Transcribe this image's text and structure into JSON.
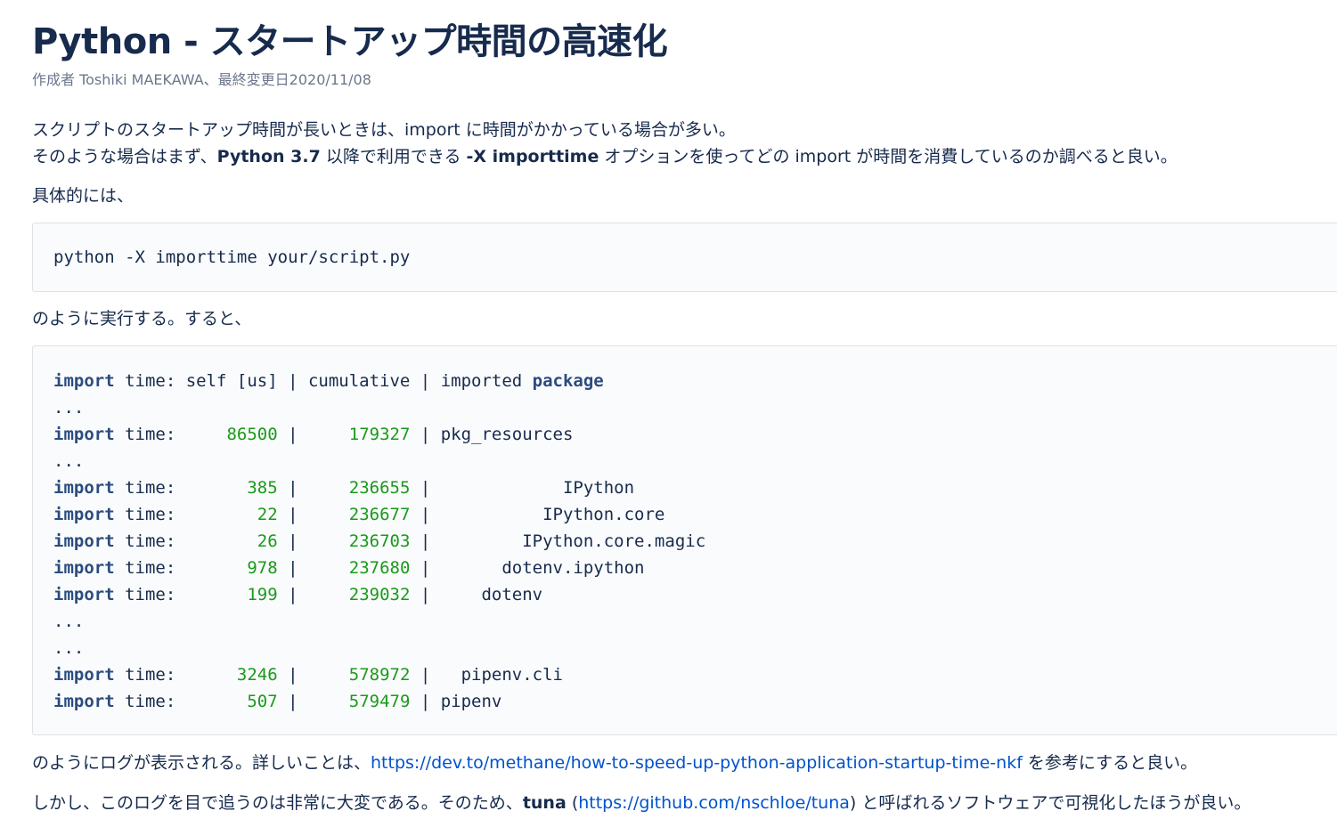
{
  "title": "Python - スタートアップ時間の高速化",
  "meta": "作成者 Toshiki MAEKAWA、最終変更日2020/11/08",
  "intro": {
    "line1": "スクリプトのスタートアップ時間が長いときは、import に時間がかかっている場合が多い。",
    "line2_a": "そのような場合はまず、",
    "line2_b": "Python 3.7",
    "line2_c": " 以降で利用できる ",
    "line2_d": "-X importtime",
    "line2_e": " オプションを使ってどの import が時間を消費しているのか調べると良い。"
  },
  "concretely": "具体的には、",
  "command": "python -X importtime your/script.py",
  "run_text": "のように実行する。すると、",
  "log": {
    "header": {
      "kw": "import",
      "mid": " time: self [us] | cumulative | imported ",
      "kw2": "package"
    },
    "rows": [
      {
        "type": "ellipsis",
        "text": "..."
      },
      {
        "type": "row",
        "kw": "import",
        "label": " time: ",
        "self": "    86500",
        "sep1": " | ",
        "cum": "    179327",
        "sep2": " | ",
        "pkg": "pkg_resources"
      },
      {
        "type": "ellipsis",
        "text": "..."
      },
      {
        "type": "row",
        "kw": "import",
        "label": " time: ",
        "self": "      385",
        "sep1": " | ",
        "cum": "    236655",
        "sep2": " | ",
        "pkg": "            IPython"
      },
      {
        "type": "row",
        "kw": "import",
        "label": " time: ",
        "self": "       22",
        "sep1": " | ",
        "cum": "    236677",
        "sep2": " | ",
        "pkg": "          IPython.core"
      },
      {
        "type": "row",
        "kw": "import",
        "label": " time: ",
        "self": "       26",
        "sep1": " | ",
        "cum": "    236703",
        "sep2": " | ",
        "pkg": "        IPython.core.magic"
      },
      {
        "type": "row",
        "kw": "import",
        "label": " time: ",
        "self": "      978",
        "sep1": " | ",
        "cum": "    237680",
        "sep2": " | ",
        "pkg": "      dotenv.ipython"
      },
      {
        "type": "row",
        "kw": "import",
        "label": " time: ",
        "self": "      199",
        "sep1": " | ",
        "cum": "    239032",
        "sep2": " | ",
        "pkg": "    dotenv"
      },
      {
        "type": "ellipsis",
        "text": "..."
      },
      {
        "type": "ellipsis",
        "text": "..."
      },
      {
        "type": "row",
        "kw": "import",
        "label": " time: ",
        "self": "     3246",
        "sep1": " | ",
        "cum": "    578972",
        "sep2": " | ",
        "pkg": "  pipenv.cli"
      },
      {
        "type": "row",
        "kw": "import",
        "label": " time: ",
        "self": "      507",
        "sep1": " | ",
        "cum": "    579479",
        "sep2": " | ",
        "pkg": "pipenv"
      }
    ]
  },
  "after_log": {
    "a": "のようにログが表示される。詳しいことは、",
    "link": "https://dev.to/methane/how-to-speed-up-python-application-startup-time-nkf",
    "b": " を参考にすると良い。"
  },
  "tuna_line": {
    "a": "しかし、このログを目で追うのは非常に大変である。そのため、",
    "b": "tuna",
    "c": " (",
    "link": "https://github.com/nschloe/tuna",
    "d": ") と呼ばれるソフトウェアで可視化したほうが良い。"
  }
}
